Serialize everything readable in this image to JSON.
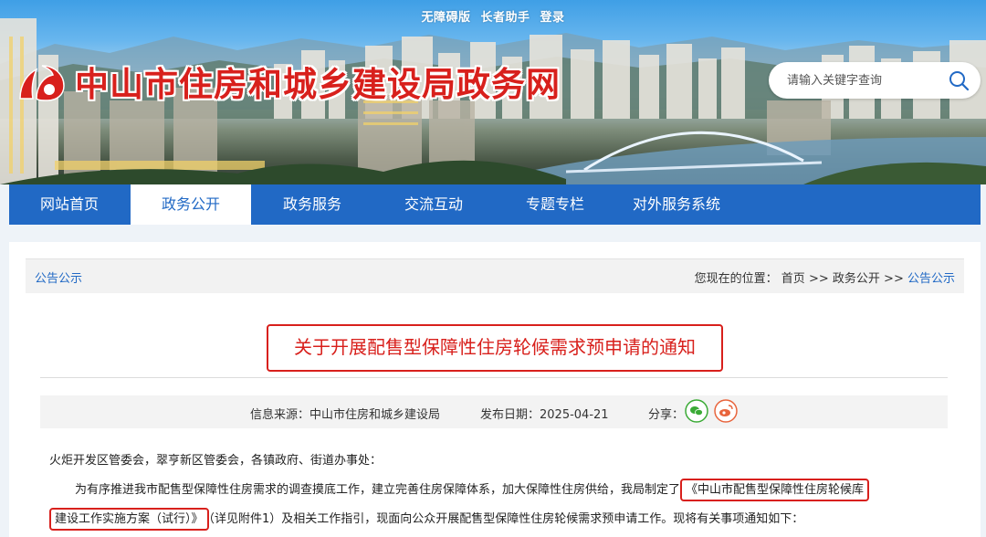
{
  "top_links": {
    "accessible": "无障碍版",
    "elder": "长者助手",
    "login": "登录"
  },
  "site": {
    "title": "中山市住房和城乡建设局政务网"
  },
  "search": {
    "placeholder": "请输入关键字查询"
  },
  "nav": {
    "items": [
      {
        "label": "网站首页"
      },
      {
        "label": "政务公开"
      },
      {
        "label": "政务服务"
      },
      {
        "label": "交流互动"
      },
      {
        "label": "专题专栏"
      },
      {
        "label": "对外服务系统"
      }
    ],
    "active_index": 1
  },
  "section_title": "公告公示",
  "breadcrumb": {
    "prefix": "您现在的位置：",
    "home": "首页",
    "sep": ">>",
    "level1": "政务公开",
    "current": "公告公示"
  },
  "article": {
    "title": "关于开展配售型保障性住房轮候需求预申请的通知",
    "source": "信息来源：中山市住房和城乡建设局",
    "date": "发布日期：2025-04-21",
    "share_label": "分享：",
    "p1": "火炬开发区管委会，翠亨新区管委会，各镇政府、街道办事处：",
    "p2_before": "为有序推进我市配售型保障性住房需求的调查摸底工作，建立完善住房保障体系，加大保障性住房供给，我局制定了",
    "p2_highlight": "《中山市配售型保障性住房轮候库",
    "p3_highlight": "建设工作实施方案（试行）》",
    "p3_after": "（详见附件1）及相关工作指引，现面向公众开展配售型保障性住房轮候需求预申请工作。现将有关事项通知如下："
  },
  "colors": {
    "brand_red": "#d8201c",
    "nav_blue": "#2169c5",
    "wechat_green": "#3aaa35",
    "weibo_orange": "#e8643c"
  }
}
